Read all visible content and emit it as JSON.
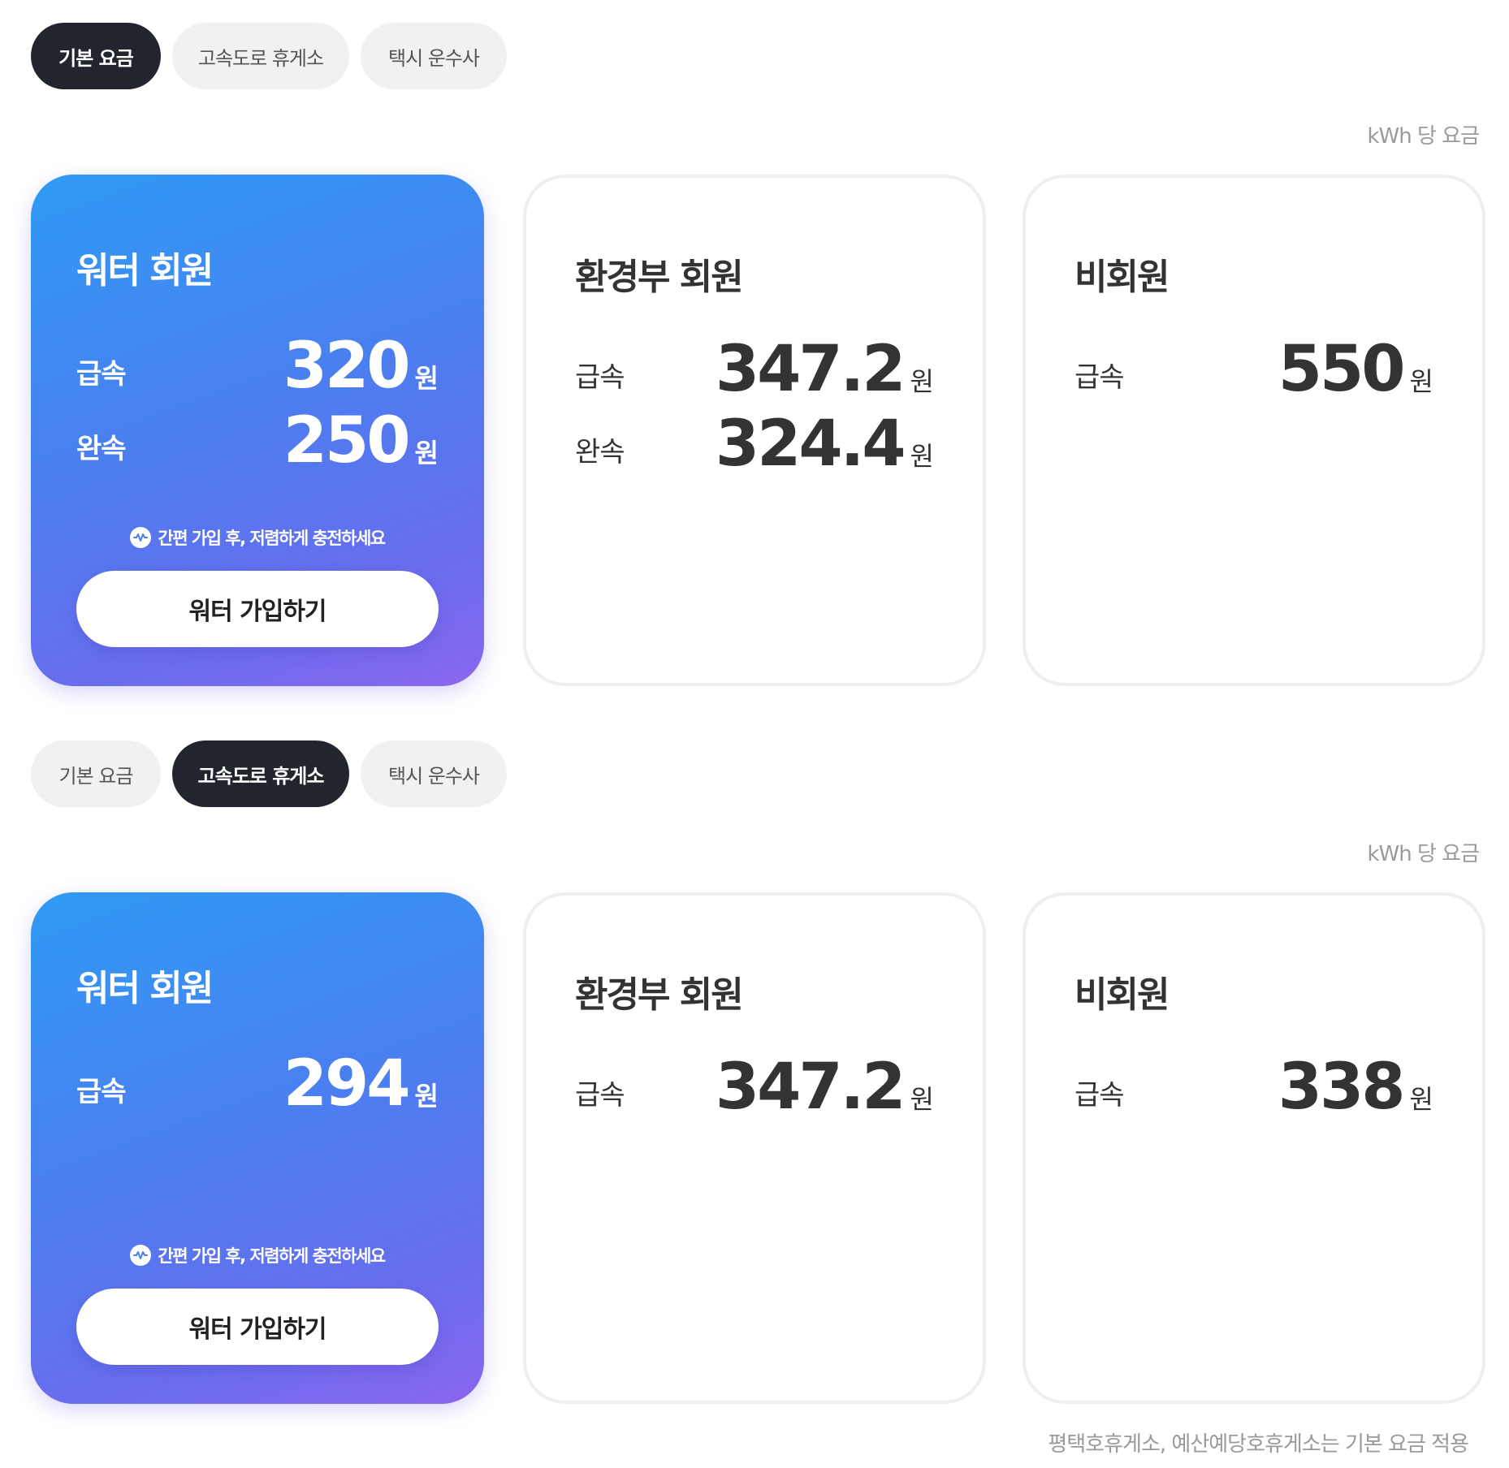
{
  "sections": [
    {
      "tabs": [
        {
          "label": "기본 요금",
          "active": true
        },
        {
          "label": "고속도로 휴게소",
          "active": false
        },
        {
          "label": "택시 운수사",
          "active": false
        }
      ],
      "unit_note": "kWh 당 요금",
      "water_card": {
        "title": "워터 회원",
        "rows": [
          {
            "label": "급속",
            "price": "320",
            "unit": "원"
          },
          {
            "label": "완속",
            "price": "250",
            "unit": "원"
          }
        ],
        "promo_text": "간편 가입 후, 저렴하게 충전하세요",
        "button_label": "워터 가입하기"
      },
      "env_card": {
        "title": "환경부 회원",
        "rows": [
          {
            "label": "급속",
            "price": "347.2",
            "unit": "원"
          },
          {
            "label": "완속",
            "price": "324.4",
            "unit": "원"
          }
        ]
      },
      "non_card": {
        "title": "비회원",
        "rows": [
          {
            "label": "급속",
            "price": "550",
            "unit": "원"
          }
        ]
      }
    },
    {
      "tabs": [
        {
          "label": "기본 요금",
          "active": false
        },
        {
          "label": "고속도로 휴게소",
          "active": true
        },
        {
          "label": "택시 운수사",
          "active": false
        }
      ],
      "unit_note": "kWh 당 요금",
      "water_card": {
        "title": "워터 회원",
        "rows": [
          {
            "label": "급속",
            "price": "294",
            "unit": "원"
          }
        ],
        "promo_text": "간편 가입 후, 저렴하게 충전하세요",
        "button_label": "워터 가입하기"
      },
      "env_card": {
        "title": "환경부 회원",
        "rows": [
          {
            "label": "급속",
            "price": "347.2",
            "unit": "원"
          }
        ]
      },
      "non_card": {
        "title": "비회원",
        "rows": [
          {
            "label": "급속",
            "price": "338",
            "unit": "원"
          }
        ]
      },
      "footnote": "평택호휴게소, 예산예당호휴게소는 기본 요금 적용"
    }
  ],
  "colors": {
    "active_tab": "#22252e",
    "inactive_tab": "#f1f1f1",
    "water_gradient_start": "#2f9bf5",
    "water_gradient_end": "#8a66ee",
    "muted_text": "#9a9a9a"
  },
  "icons": {
    "promo": "water-logo-icon"
  }
}
